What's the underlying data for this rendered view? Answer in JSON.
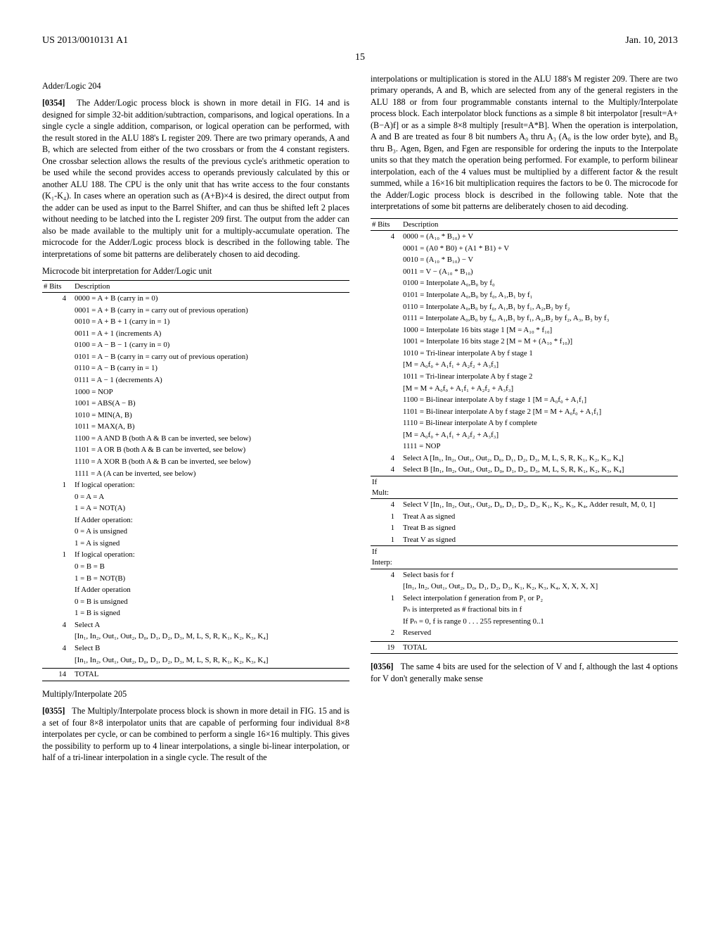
{
  "header": {
    "left": "US 2013/0010131 A1",
    "right": "Jan. 10, 2013",
    "page": "15"
  },
  "adder": {
    "heading": "Adder/Logic 204",
    "para_num": "[0354]",
    "para": "The Adder/Logic process block is shown in more detail in FIG. 14 and is designed for simple 32-bit addition/subtraction, comparisons, and logical operations. In a single cycle a single addition, comparison, or logical operation can be performed, with the result stored in the ALU 188's L register 209. There are two primary operands, A and B, which are selected from either of the two crossbars or from the 4 constant registers. One crossbar selection allows the results of the previous cycle's arithmetic operation to be used while the second provides access to operands previously calculated by this or another ALU 188. The CPU is the only unit that has write access to the four constants (K₁-K₄). In cases where an operation such as (A+B)×4 is desired, the direct output from the adder can be used as input to the Barrel Shifter, and can thus be shifted left 2 places without needing to be latched into the L register 209 first. The output from the adder can also be made available to the multiply unit for a multiply-accumulate operation. The microcode for the Adder/Logic process block is described in the following table. The interpretations of some bit patterns are deliberately chosen to aid decoding.",
    "caption": "Microcode bit interpretation for Adder/Logic unit",
    "table": {
      "head_bits": "# Bits",
      "head_desc": "Description",
      "rows": [
        {
          "bits": "4",
          "desc": "0000 = A + B (carry in = 0)"
        },
        {
          "bits": "",
          "desc": "0001 = A + B (carry in = carry out of previous operation)"
        },
        {
          "bits": "",
          "desc": "0010 = A + B + 1 (carry in = 1)"
        },
        {
          "bits": "",
          "desc": "0011 = A + 1 (increments A)"
        },
        {
          "bits": "",
          "desc": "0100 = A − B − 1 (carry in = 0)"
        },
        {
          "bits": "",
          "desc": "0101 = A − B (carry in = carry out of previous operation)"
        },
        {
          "bits": "",
          "desc": "0110 = A − B (carry in = 1)"
        },
        {
          "bits": "",
          "desc": "0111 = A − 1 (decrements A)"
        },
        {
          "bits": "",
          "desc": "1000 = NOP"
        },
        {
          "bits": "",
          "desc": "1001 = ABS(A − B)"
        },
        {
          "bits": "",
          "desc": "1010 = MIN(A, B)"
        },
        {
          "bits": "",
          "desc": "1011 = MAX(A, B)"
        },
        {
          "bits": "",
          "desc": "1100 = A AND B (both A & B can be inverted, see below)"
        },
        {
          "bits": "",
          "desc": "1101 = A OR B (both A & B can be inverted, see below)"
        },
        {
          "bits": "",
          "desc": "1110 = A XOR B (both A & B can be inverted, see below)"
        },
        {
          "bits": "",
          "desc": "1111 = A (A can be inverted, see below)"
        },
        {
          "bits": "1",
          "desc": "If logical operation:"
        },
        {
          "bits": "",
          "desc": "0 = A = A"
        },
        {
          "bits": "",
          "desc": "1 = A = NOT(A)"
        },
        {
          "bits": "",
          "desc": "If Adder operation:"
        },
        {
          "bits": "",
          "desc": "0 = A is unsigned"
        },
        {
          "bits": "",
          "desc": "1 = A is signed"
        },
        {
          "bits": "1",
          "desc": "If logical operation:"
        },
        {
          "bits": "",
          "desc": "0 = B = B"
        },
        {
          "bits": "",
          "desc": "1 = B = NOT(B)"
        },
        {
          "bits": "",
          "desc": "If Adder operation"
        },
        {
          "bits": "",
          "desc": "0 = B is unsigned"
        },
        {
          "bits": "",
          "desc": "1 = B is signed"
        },
        {
          "bits": "4",
          "desc": "Select A"
        },
        {
          "bits": "",
          "desc": "[In₁, In₂, Out₁, Out₂, D₀, D₁, D₂, D₃, M, L, S, R, K₁, K₂, K₃, K₄]"
        },
        {
          "bits": "4",
          "desc": "Select B"
        },
        {
          "bits": "",
          "desc": "[In₁, In₂, Out₁, Out₂, D₀, D₁, D₂, D₃, M, L, S, R, K₁, K₂, K₃, K₄]"
        }
      ],
      "total_bits": "14",
      "total_label": "TOTAL"
    }
  },
  "multiply": {
    "heading": "Multiply/Interpolate 205",
    "para_num": "[0355]",
    "para_first": "The Multiply/Interpolate process block is shown in more detail in FIG. 15 and is a set of four 8×8 interpolator units that are capable of performing four individual 8×8 interpolates per cycle, or can be combined to perform a single 16×16 multiply. This gives the possibility to perform up to 4 linear interpolations, a single bi-linear interpolation, or half of a tri-linear interpolation in a single cycle. The result of the",
    "para_cont": "interpolations or multiplication is stored in the ALU 188's M register 209. There are two primary operands, A and B, which are selected from any of the general registers in the ALU 188 or from four programmable constants internal to the Multiply/Interpolate process block. Each interpolator block functions as a simple 8 bit interpolator [result=A+(B−A)f] or as a simple 8×8 multiply [result=A*B]. When the operation is interpolation, A and B are treated as four 8 bit numbers A₀ thru A₃ (A₀ is the low order byte), and B₀ thru B₃. Agen, Bgen, and Fgen are responsible for ordering the inputs to the Interpolate units so that they match the operation being performed. For example, to perform bilinear interpolation, each of the 4 values must be multiplied by a different factor & the result summed, while a 16×16 bit multiplication requires the factors to be 0. The microcode for the Adder/Logic process block is described in the following table. Note that the interpretations of some bit patterns are deliberately chosen to aid decoding.",
    "table": {
      "head_bits": "# Bits",
      "head_desc": "Description",
      "rows": [
        {
          "bits": "4",
          "desc": "0000 = (A₁₀ * B₁₀) + V"
        },
        {
          "bits": "",
          "desc": "0001 = (A0 * B0) + (A1 * B1) + V"
        },
        {
          "bits": "",
          "desc": "0010 = (A₁₀ * B₁₀) − V"
        },
        {
          "bits": "",
          "desc": "0011 = V − (A₁₀ * B₁₀)"
        },
        {
          "bits": "",
          "desc": "0100 = Interpolate A₀,B₀ by f₀"
        },
        {
          "bits": "",
          "desc": "0101 = Interpolate A₀,B₀ by f₀, A₁,B₁ by f₁"
        },
        {
          "bits": "",
          "desc": "0110 = Interpolate A₀,B₀ by f₀, A₁,B₁ by f₁, A₂,B₂ by f₂"
        },
        {
          "bits": "",
          "desc": "0111 = Interpolate A₀,B₀ by f₀, A₁,B₁ by f₁, A₂,B₂ by f₂, A₃, B₃ by f₃"
        },
        {
          "bits": "",
          "desc": "1000 = Interpolate 16 bits stage 1 [M = A₁₀ * f₁₀]"
        },
        {
          "bits": "",
          "desc": "1001 = Interpolate 16 bits stage 2 [M = M + (A₁₀ * f₁₀)]"
        },
        {
          "bits": "",
          "desc": "1010 = Tri-linear interpolate A by f stage 1"
        },
        {
          "bits": "",
          "desc": "[M = A₀f₀ + A₁f₁ + A₂f₂ + A₃f₃]"
        },
        {
          "bits": "",
          "desc": "1011 = Tri-linear interpolate A by f stage 2"
        },
        {
          "bits": "",
          "desc": "[M = M + A₀f₀ + A₁f₁ + A₂f₂ + A₃f₃]"
        },
        {
          "bits": "",
          "desc": "1100 = Bi-linear interpolate A by f stage 1 [M = A₀f₀ + A₁f₁]"
        },
        {
          "bits": "",
          "desc": "1101 = Bi-linear interpolate A by f stage 2 [M = M + A₀f₀ + A₁f₁]"
        },
        {
          "bits": "",
          "desc": "1110 = Bi-linear interpolate A by f complete"
        },
        {
          "bits": "",
          "desc": "[M = A₀f₀ + A₁f₁ + A₂f₂ + A₃f₃]"
        },
        {
          "bits": "",
          "desc": "1111 = NOP"
        },
        {
          "bits": "4",
          "desc": "Select A [In₁, In₂, Out₁, Out₂, D₀, D₁, D₂, D₃, M, L, S, R, K₁, K₂, K₃, K₄]"
        },
        {
          "bits": "4",
          "desc": "Select B [In₁, In₂, Out₁, Out₂, D₀, D₁, D₂, D₃, M, L, S, R, K₁, K₂, K₃, K₄]"
        },
        {
          "bits": "If Mult:",
          "desc": ""
        },
        {
          "bits": "4",
          "desc": "Select V [In₁, In₂, Out₁, Out₂, D₀, D₁, D₂, D₃, K₁, K₂, K₃, K₄, Adder result, M, 0, 1]"
        },
        {
          "bits": "1",
          "desc": "Treat A as signed"
        },
        {
          "bits": "1",
          "desc": "Treat B as signed"
        },
        {
          "bits": "1",
          "desc": "Treat V as signed"
        },
        {
          "bits": "If Interp:",
          "desc": ""
        },
        {
          "bits": "4",
          "desc": "Select basis for f"
        },
        {
          "bits": "",
          "desc": "[In₁, In₂, Out₁, Out₂, D₀, D₁, D₂, D₃, K₁, K₂, K₃, K₄, X, X, X, X]"
        },
        {
          "bits": "1",
          "desc": "Select interpolation f generation from P₁ or P₂"
        },
        {
          "bits": "",
          "desc": "Pₙ is interpreted as # fractional bits in f"
        },
        {
          "bits": "",
          "desc": "If Pₙ = 0, f is range 0 . . . 255 representing 0..1"
        },
        {
          "bits": "2",
          "desc": "Reserved"
        }
      ],
      "total_bits": "19",
      "total_label": "TOTAL"
    },
    "para2_num": "[0356]",
    "para2": "The same 4 bits are used for the selection of V and f, although the last 4 options for V don't generally make sense"
  }
}
